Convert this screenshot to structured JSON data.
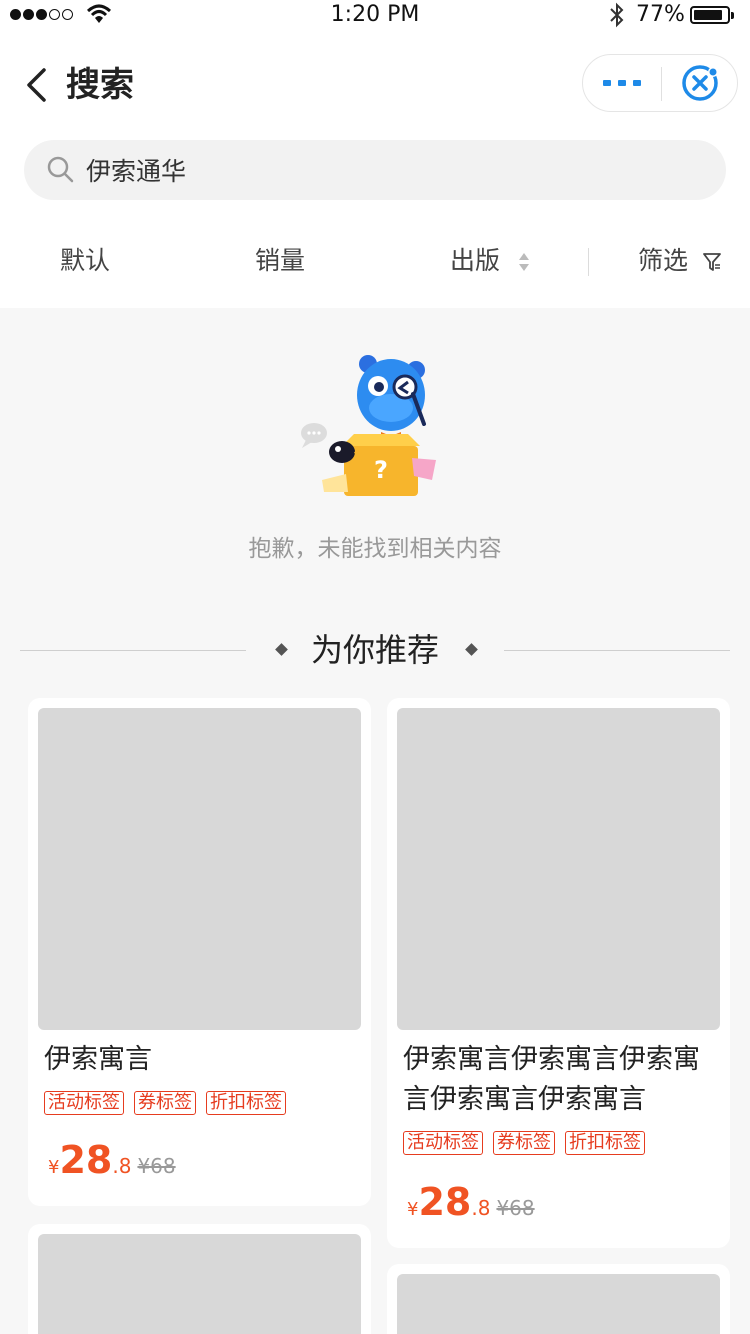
{
  "status_bar": {
    "time": "1:20 PM",
    "battery": "77%"
  },
  "nav": {
    "title": "搜索"
  },
  "search": {
    "value": "伊索通华"
  },
  "sort_tabs": {
    "default": "默认",
    "sales": "销量",
    "publish": "出版",
    "filter": "筛选"
  },
  "empty_state": {
    "message": "抱歉，未能找到相关内容"
  },
  "recommend": {
    "title": "为你推荐"
  },
  "products": [
    {
      "title": "伊索寓言",
      "tags": [
        "活动标签",
        "券标签",
        "折扣标签"
      ],
      "currency": "¥",
      "price_int": "28",
      "price_dec": ".8",
      "original_price": "¥68"
    },
    {
      "title": "伊索寓言伊索寓言伊索寓言伊索寓言伊索寓言",
      "tags": [
        "活动标签",
        "券标签",
        "折扣标签"
      ],
      "currency": "¥",
      "price_int": "28",
      "price_dec": ".8",
      "original_price": "¥68"
    }
  ],
  "colors": {
    "accent": "#1e8ae8",
    "price": "#f05323",
    "tag": "#e63c1f",
    "placeholder": "#d8d8d8"
  }
}
